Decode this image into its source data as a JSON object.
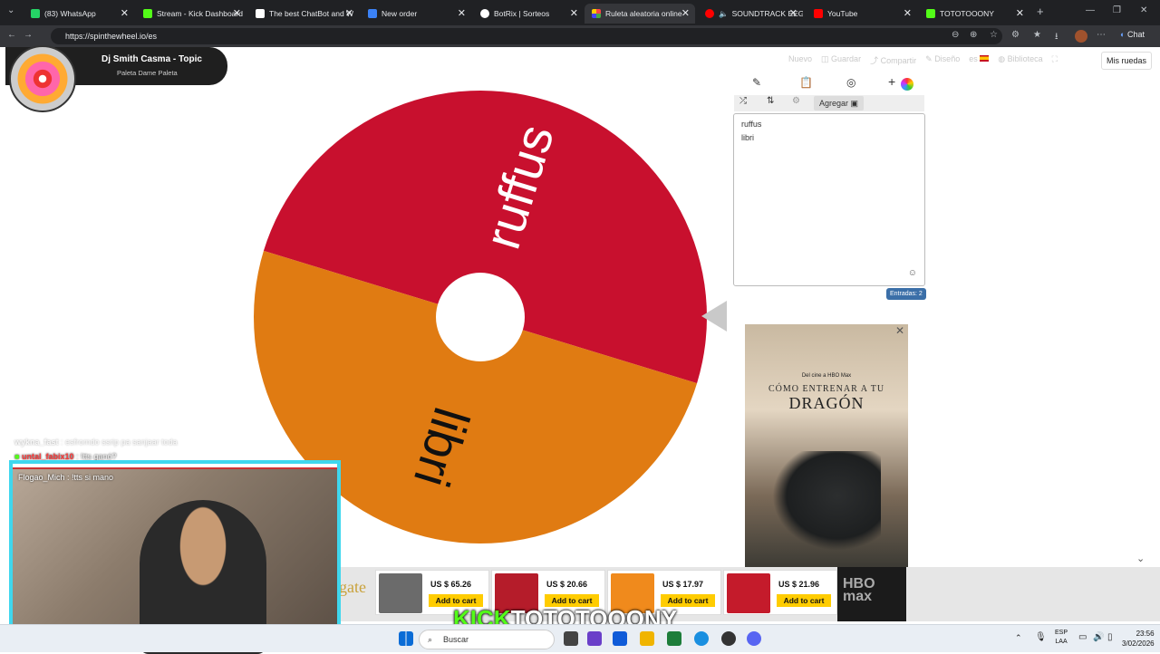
{
  "browser": {
    "tabs": [
      {
        "label": "(83) WhatsApp",
        "color": "#25d366"
      },
      {
        "label": "Stream - Kick Dashboard",
        "color": "#53fc18"
      },
      {
        "label": "The best ChatBot and W",
        "color": "#ffffff"
      },
      {
        "label": "New order",
        "color": "#3b82f6"
      },
      {
        "label": "BotRix | Sorteos",
        "color": "#ffffff"
      },
      {
        "label": "Ruleta aleatoria online",
        "color": "#f4b400"
      },
      {
        "label": "SOUNDTRACK EEG",
        "color": "#ff0000"
      },
      {
        "label": "YouTube",
        "color": "#ff0000"
      },
      {
        "label": "TOTOTOOONY",
        "color": "#53fc18"
      }
    ],
    "url": "https://spinthewheel.io/es",
    "chat_button": "Chat"
  },
  "music": {
    "title": "Dj Smith Casma - Topic",
    "artist": "Paleta Dame Paleta"
  },
  "nav": {
    "items": [
      "Nuevo",
      "Guardar",
      "Compartir",
      "Diseño",
      "es",
      "Biblioteca"
    ],
    "mis_ruedas": "Mis ruedas"
  },
  "editor": {
    "add_label": "Agregar",
    "entries": [
      "ruffus",
      "libri"
    ],
    "count_label": "Entradas: 2"
  },
  "wheel": {
    "segments": [
      {
        "label": "ruffus",
        "color": "#c8102e"
      },
      {
        "label": "libri",
        "color": "#e07b12"
      }
    ]
  },
  "ad": {
    "sub": "Del cine a HBO Max",
    "title_small": "CÓMO ENTRENAR A TU",
    "title_big": "DRAGÓN",
    "brand": "HBO max"
  },
  "shop": {
    "logo": "gate",
    "items": [
      {
        "price": "US $ 65.26",
        "cart": "Add to cart",
        "color": "#6b6b6b"
      },
      {
        "price": "US $ 20.66",
        "cart": "Add to cart",
        "color": "#b51c2a"
      },
      {
        "price": "US $ 17.97",
        "cart": "Add to cart",
        "color": "#f08a1c"
      },
      {
        "price": "US $ 21.96",
        "cart": "Add to cart",
        "color": "#c41b2b"
      }
    ]
  },
  "stream": {
    "chat": [
      {
        "user": "wykna_fast",
        "msg": "esfromdo ssrip pa sanjaar toda"
      },
      {
        "user": "untal_fabix10",
        "msg": "!tts ganó?"
      }
    ],
    "cam_chat": "Flogao_Mich : !tts si mano",
    "brand_k": "KICK",
    "brand_name": "TOTOTOOONY"
  },
  "taskbar": {
    "search": "Buscar",
    "lang1": "ESP",
    "lang2": "LAA",
    "time": "23:56",
    "date": "3/02/2026"
  }
}
